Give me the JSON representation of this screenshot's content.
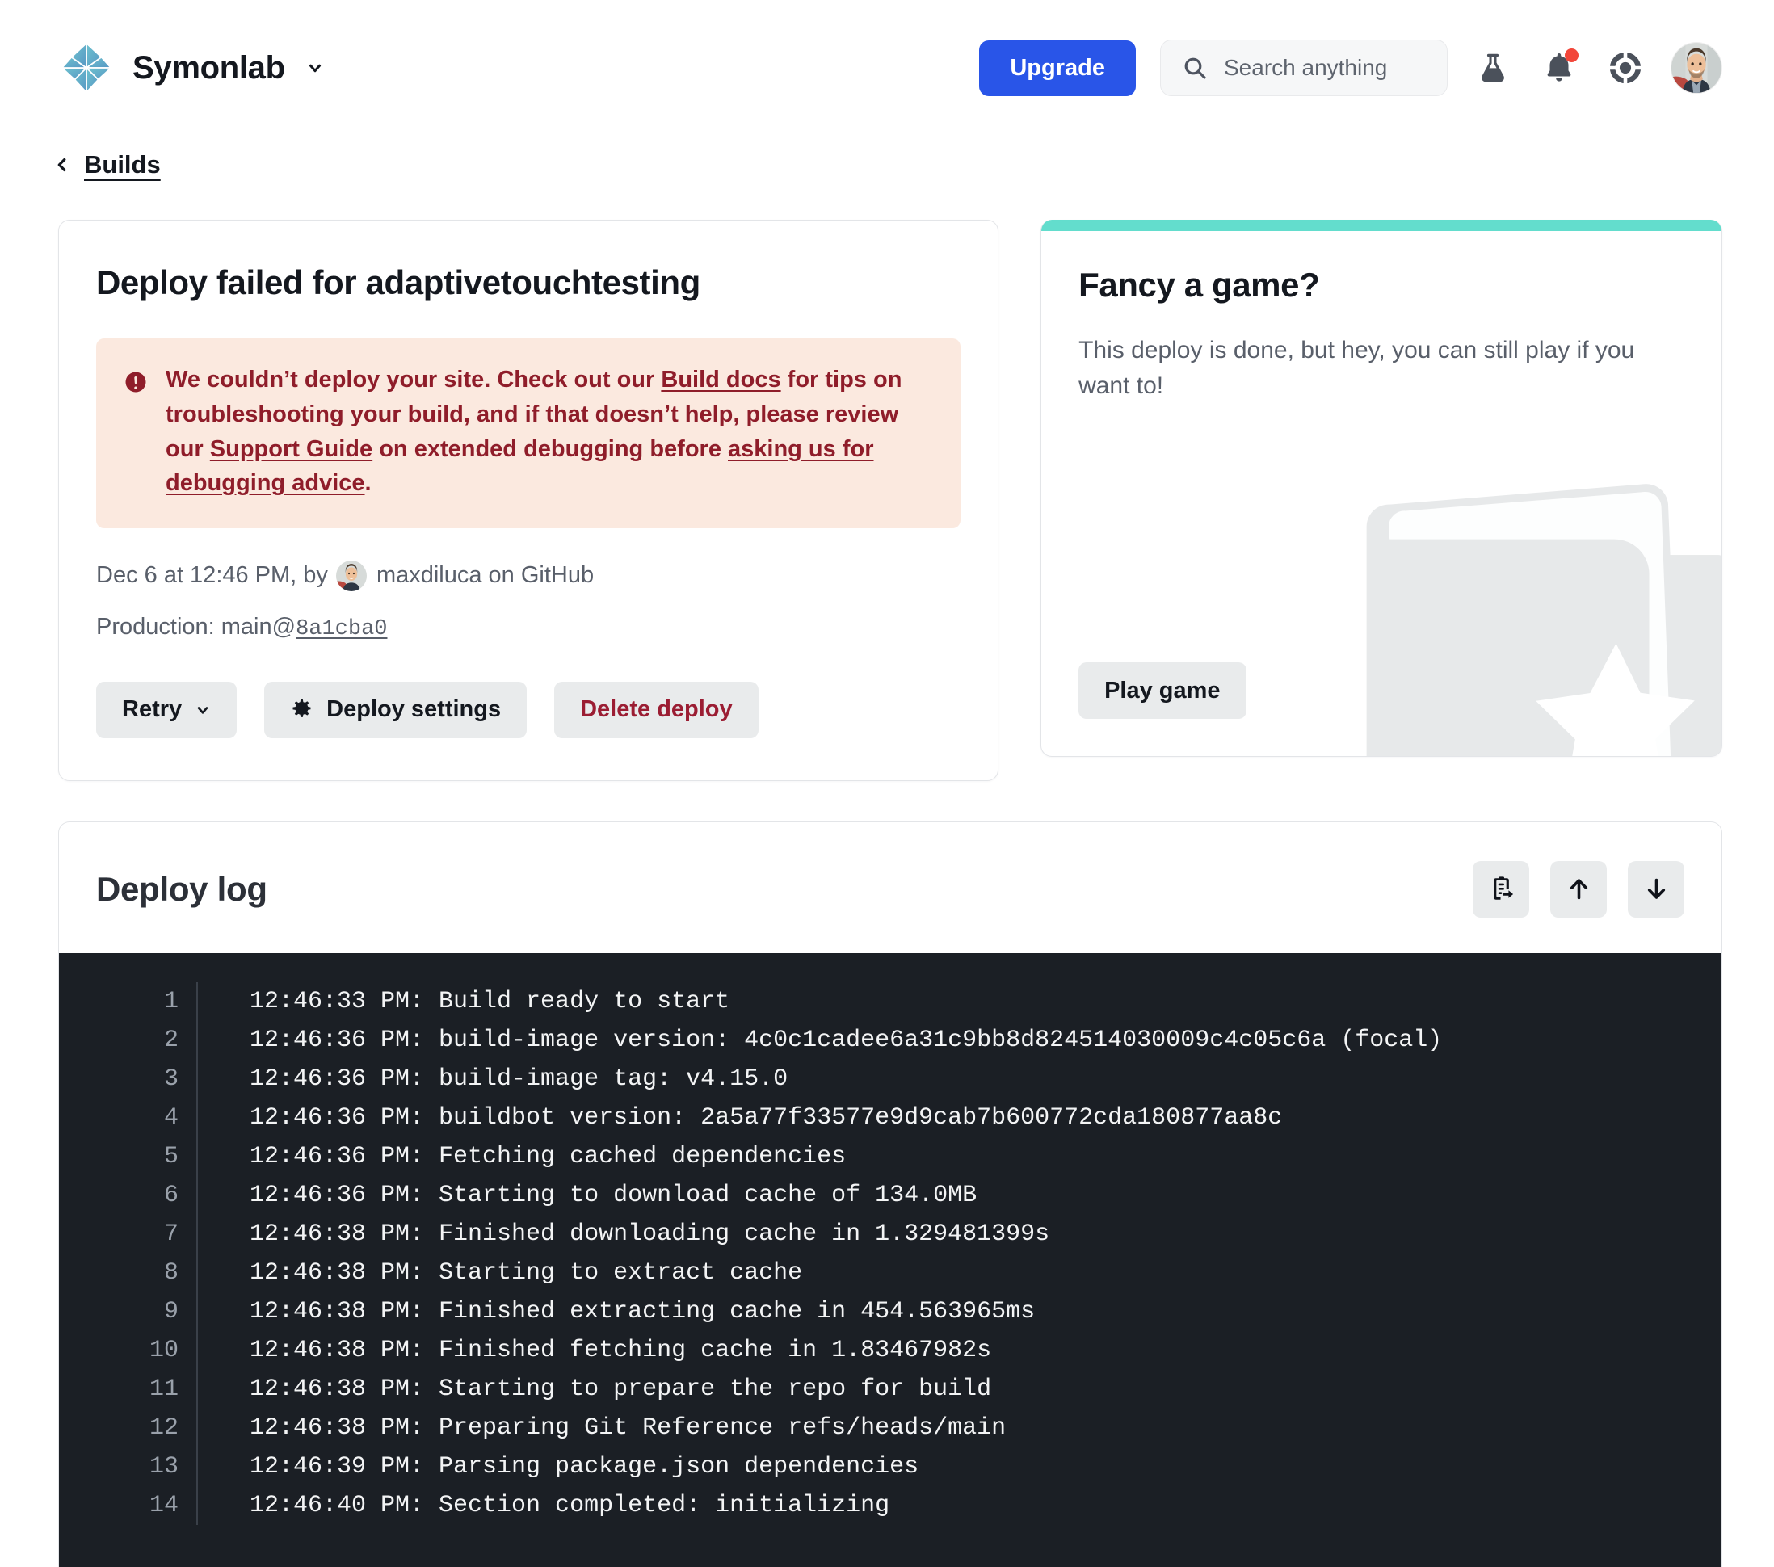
{
  "header": {
    "brand": "Symonlab",
    "brand_caret_icon": "chevron-down-icon",
    "logo_icon": "symonlab-diamond-logo",
    "upgrade_label": "Upgrade",
    "search": {
      "placeholder": "Search anything",
      "value": "",
      "icon": "search-icon"
    },
    "icons": [
      {
        "name": "flask-icon",
        "label": "Labs"
      },
      {
        "name": "bell-icon",
        "label": "Notifications",
        "badge": true
      },
      {
        "name": "lifebuoy-icon",
        "label": "Support"
      }
    ],
    "avatar_icon": "user-avatar"
  },
  "breadcrumb": {
    "back_icon": "chevron-left-icon",
    "label": "Builds"
  },
  "deploy_card": {
    "title": "Deploy failed for adaptivetouchtesting",
    "alert": {
      "icon": "alert-circle-icon",
      "part1": "We couldn’t deploy your site. Check out our ",
      "link1": "Build docs",
      "part2": " for tips on troubleshooting your build, and if that doesn’t help, please review our ",
      "link2": "Support Guide",
      "part3": " on extended debugging before ",
      "link3": "asking us for debugging advice",
      "part4": "."
    },
    "meta": {
      "timestamp": "Dec 6 at 12:46 PM, by",
      "author": "maxdiluca on GitHub",
      "avatar_icon": "author-avatar"
    },
    "production": {
      "prefix": "Production: main@",
      "commit": "8a1cba0"
    },
    "buttons": {
      "retry": "Retry",
      "retry_caret_icon": "chevron-down-icon",
      "deploy_settings": "Deploy settings",
      "deploy_settings_icon": "gear-icon",
      "delete_deploy": "Delete deploy"
    }
  },
  "game_card": {
    "accent_color": "#63ddcd",
    "title": "Fancy a game?",
    "body": "This deploy is done, but hey, you can still play if you want to!",
    "play_label": "Play game",
    "deco_icon": "cards-star-illustration"
  },
  "log_panel": {
    "title": "Deploy log",
    "actions": [
      {
        "name": "copy-to-clipboard-icon",
        "label": "Copy log"
      },
      {
        "name": "arrow-up-icon",
        "label": "Scroll to top"
      },
      {
        "name": "arrow-down-icon",
        "label": "Scroll to bottom"
      }
    ],
    "lines": [
      {
        "n": "1",
        "text": "12:46:33 PM: Build ready to start"
      },
      {
        "n": "2",
        "text": "12:46:36 PM: build-image version: 4c0c1cadee6a31c9bb8d824514030009c4c05c6a (focal)"
      },
      {
        "n": "3",
        "text": "12:46:36 PM: build-image tag: v4.15.0"
      },
      {
        "n": "4",
        "text": "12:46:36 PM: buildbot version: 2a5a77f33577e9d9cab7b600772cda180877aa8c"
      },
      {
        "n": "5",
        "text": "12:46:36 PM: Fetching cached dependencies"
      },
      {
        "n": "6",
        "text": "12:46:36 PM: Starting to download cache of 134.0MB"
      },
      {
        "n": "7",
        "text": "12:46:38 PM: Finished downloading cache in 1.329481399s"
      },
      {
        "n": "8",
        "text": "12:46:38 PM: Starting to extract cache"
      },
      {
        "n": "9",
        "text": "12:46:38 PM: Finished extracting cache in 454.563965ms"
      },
      {
        "n": "10",
        "text": "12:46:38 PM: Finished fetching cache in 1.83467982s"
      },
      {
        "n": "11",
        "text": "12:46:38 PM: Starting to prepare the repo for build"
      },
      {
        "n": "12",
        "text": "12:46:38 PM: Preparing Git Reference refs/heads/main"
      },
      {
        "n": "13",
        "text": "12:46:39 PM: Parsing package.json dependencies"
      },
      {
        "n": "14",
        "text": "12:46:40 PM: Section completed: initializing"
      }
    ]
  }
}
